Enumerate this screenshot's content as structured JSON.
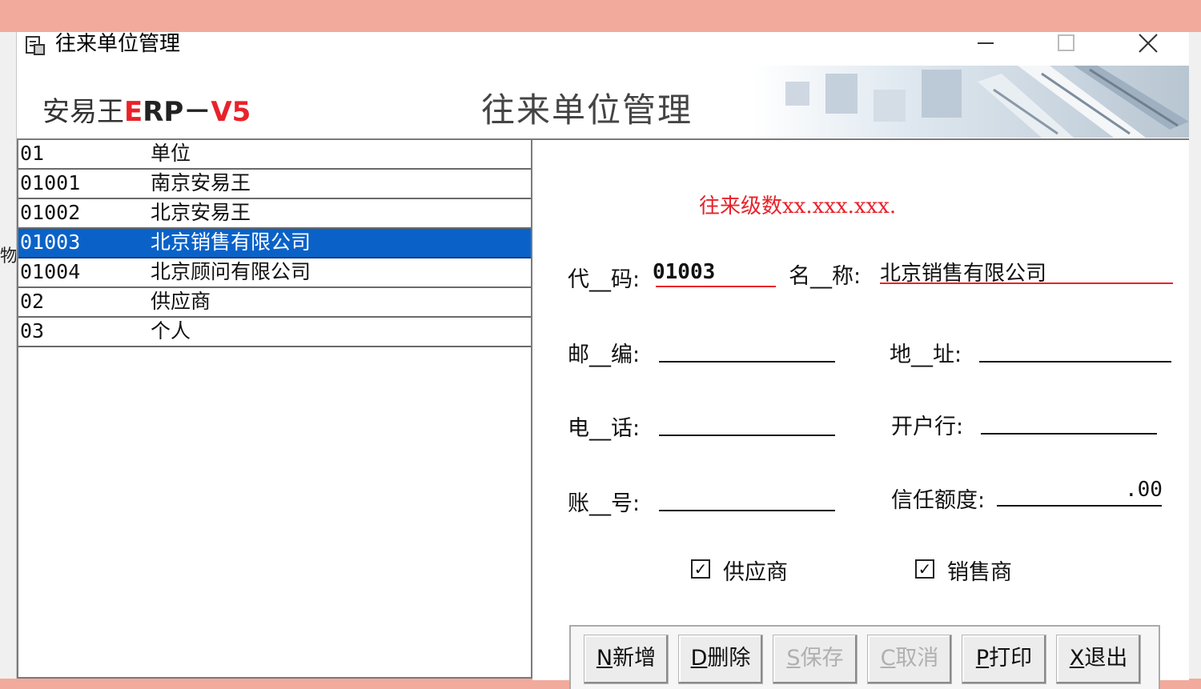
{
  "window": {
    "title": "往来单位管理",
    "controls": {
      "minimize": "minimize-icon",
      "maximize": "maximize-icon",
      "close": "close-icon"
    }
  },
  "header": {
    "brand_part1": "安易王",
    "brand_part2": "E",
    "brand_part3": "RP－",
    "brand_part4": "V5",
    "heading": "往来单位管理"
  },
  "tree": {
    "rows": [
      {
        "code": "01",
        "name": "单位",
        "selected": false
      },
      {
        "code": "01001",
        "name": "南京安易王",
        "selected": false
      },
      {
        "code": "01002",
        "name": "北京安易王",
        "selected": false
      },
      {
        "code": "01003",
        "name": "北京销售有限公司",
        "selected": true
      },
      {
        "code": "01004",
        "name": "北京顾问有限公司",
        "selected": false
      },
      {
        "code": "02",
        "name": "供应商",
        "selected": false
      },
      {
        "code": "03",
        "name": "个人",
        "selected": false
      }
    ]
  },
  "form": {
    "level_text": "往来级数xx.xxx.xxx.",
    "code_label": "代__码:",
    "code_value": "01003",
    "name_label": "名__称:",
    "name_value": "北京销售有限公司",
    "postcode_label": "邮__编:",
    "postcode_value": "",
    "address_label": "地__址:",
    "address_value": "",
    "phone_label": "电__话:",
    "phone_value": "",
    "bank_label": "开户行:",
    "bank_value": "",
    "account_label": "账__号:",
    "account_value": "",
    "credit_label": "信任额度:",
    "credit_value": ".00",
    "supplier_label": "供应商",
    "supplier_checked": true,
    "seller_label": "销售商",
    "seller_checked": true
  },
  "buttons": [
    {
      "key": "N",
      "label": "新增",
      "enabled": true
    },
    {
      "key": "D",
      "label": "删除",
      "enabled": true
    },
    {
      "key": "S",
      "label": "保存",
      "enabled": false
    },
    {
      "key": "C",
      "label": "取消",
      "enabled": false
    },
    {
      "key": "P",
      "label": "打印",
      "enabled": true
    },
    {
      "key": "X",
      "label": "退出",
      "enabled": true
    }
  ],
  "side_fragment": "物",
  "colors": {
    "accent_red": "#e8222a",
    "selection_blue": "#0a62c8",
    "background": "#f2aa9c"
  }
}
